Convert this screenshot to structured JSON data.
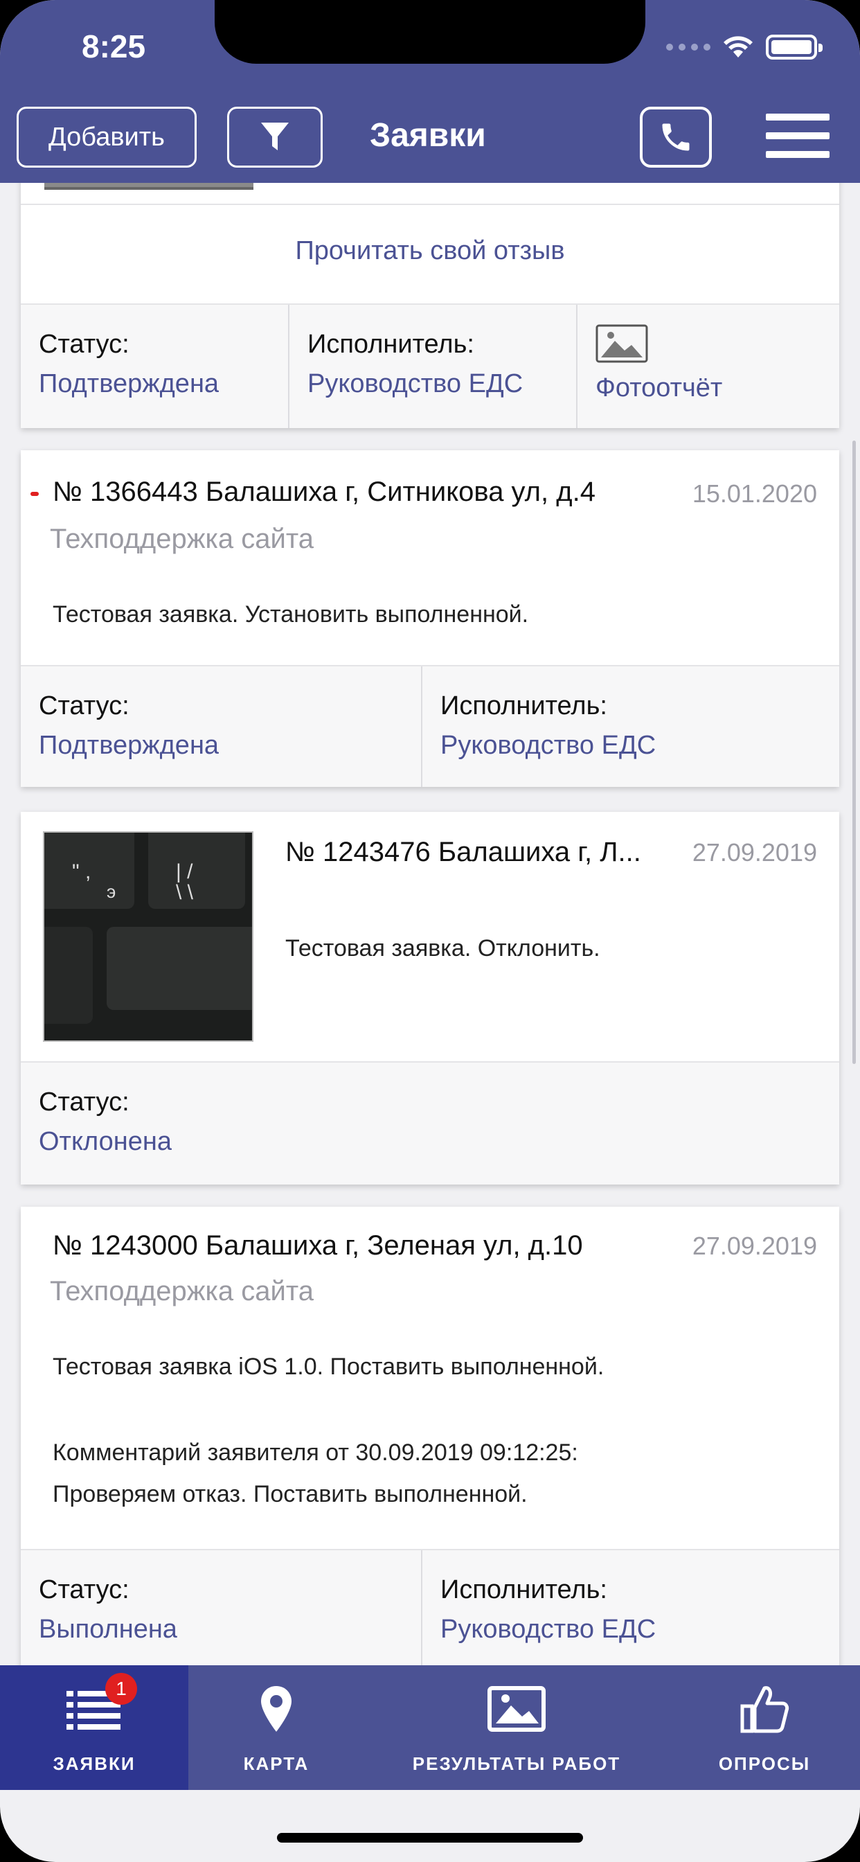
{
  "status_bar": {
    "time": "8:25"
  },
  "header": {
    "add_label": "Добавить",
    "title": "Заявки"
  },
  "card_top": {
    "read_review": "Прочитать свой отзыв",
    "status_label": "Статус:",
    "status_value": "Подтверждена",
    "executor_label": "Исполнитель:",
    "executor_value": "Руководство ЕДС",
    "photo_report": "Фотоотчёт"
  },
  "orders": [
    {
      "title": "№ 1366443 Балашиха г, Ситникова ул, д.4",
      "date": "15.01.2020",
      "category": "Техподдержка сайта",
      "text": "Тестовая заявка. Установить выполненной.",
      "status_label": "Статус:",
      "status_value": "Подтверждена",
      "executor_label": "Исполнитель:",
      "executor_value": "Руководство ЕДС",
      "unread": true
    },
    {
      "title": "№ 1243476 Балашиха г, Л...",
      "date": "27.09.2019",
      "text": "Тестовая заявка. Отклонить.",
      "status_label": "Статус:",
      "status_value": "Отклонена"
    },
    {
      "title": "№ 1243000 Балашиха г, Зеленая ул, д.10",
      "date": "27.09.2019",
      "category": "Техподдержка сайта",
      "text": "Тестовая заявка iOS 1.0. Поставить выполненной.",
      "comment_header": "Комментарий заявителя от 30.09.2019 09:12:25:",
      "comment_text": "Проверяем отказ. Поставить выполненной.",
      "status_label": "Статус:",
      "status_value": "Выполнена",
      "executor_label": "Исполнитель:",
      "executor_value": "Руководство ЕДС"
    }
  ],
  "tabbar": {
    "tabs": [
      {
        "label": "ЗАЯВКИ",
        "icon": "list-icon",
        "badge": "1",
        "active": true
      },
      {
        "label": "КАРТА",
        "icon": "map-pin-icon"
      },
      {
        "label": "РЕЗУЛЬТАТЫ РАБОТ",
        "icon": "image-icon"
      },
      {
        "label": "ОПРОСЫ",
        "icon": "thumbs-up-icon"
      }
    ]
  },
  "colors": {
    "primary": "#4b5294",
    "tab_active": "#2d3590",
    "link": "#4b5294",
    "badge": "#e02020",
    "unread_dot": "#e02020"
  }
}
